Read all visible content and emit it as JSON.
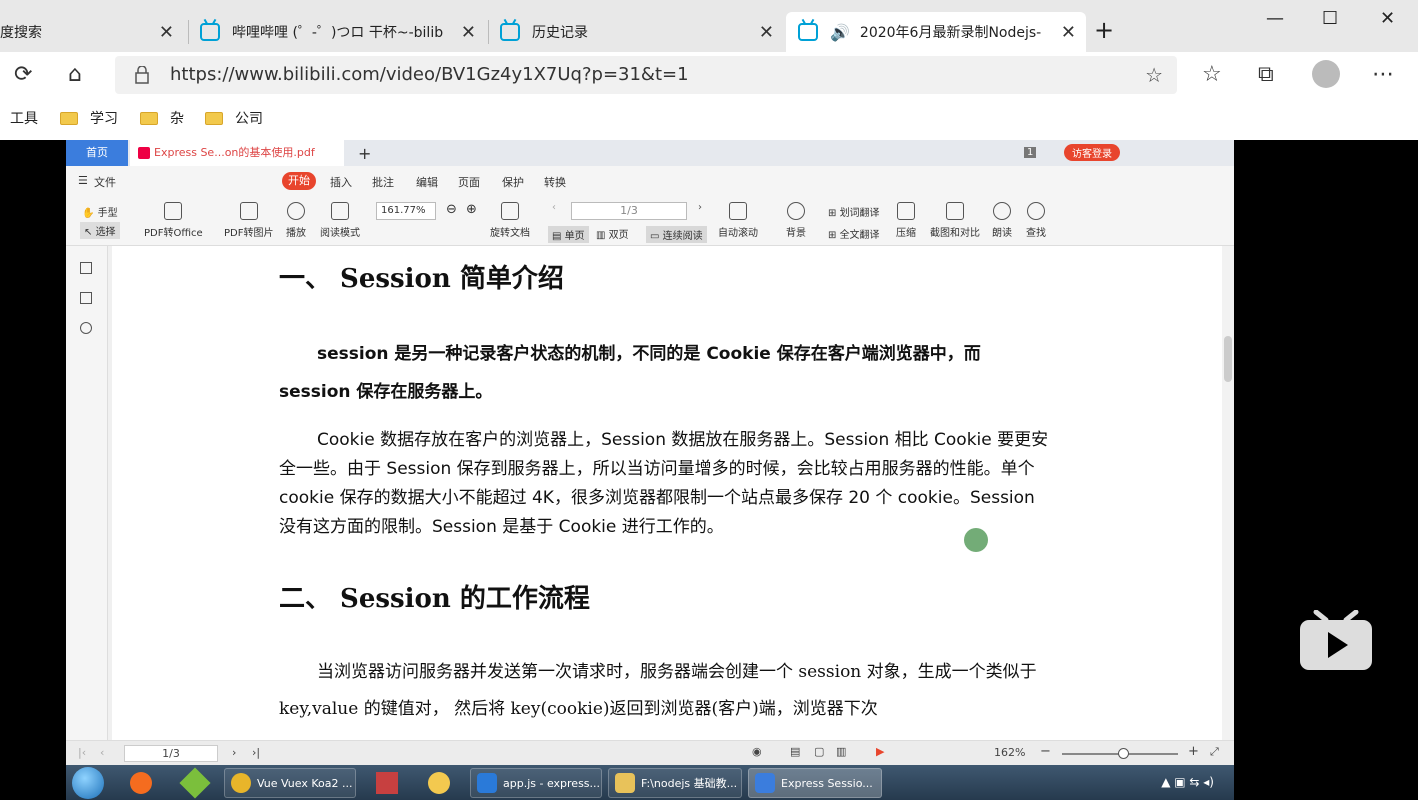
{
  "tabs": [
    {
      "title": "度搜索",
      "close": "✕"
    },
    {
      "title": "哔哩哔哩 (゜-゜)つロ 干杯~-bilib",
      "close": "✕"
    },
    {
      "title": "历史记录",
      "close": "✕"
    },
    {
      "title": "2020年6月最新录制Nodejs-",
      "close": "✕"
    }
  ],
  "new_tab": "+",
  "window_controls": {
    "minimize": "—",
    "maximize": "☐",
    "close": "✕"
  },
  "url": "https://www.bilibili.com/video/BV1Gz4y1X7Uq?p=31&t=1",
  "favorites": {
    "tools": "工具",
    "items": [
      "学习",
      "杂",
      "公司"
    ]
  },
  "wps": {
    "home_tab": "首页",
    "doc_tab": "Express  Se...on的基本使用.pdf",
    "add_tab": "+",
    "page_badge": "1",
    "login": "访客登录",
    "menu": {
      "file": "文件",
      "start": "开始",
      "insert": "插入",
      "annotate": "批注",
      "edit": "编辑",
      "page": "页面",
      "protect": "保护",
      "convert": "转换"
    },
    "toolbar": {
      "hand": "手型",
      "select": "选择",
      "pdf_to_office": "PDF转Office",
      "pdf_to_image": "PDF转图片",
      "play": "播放",
      "read_mode": "阅读模式",
      "zoom": "161.77%",
      "rotate": "旋转文档",
      "page_field": "1/3",
      "single": "单页",
      "double": "双页",
      "continuous": "连续阅读",
      "autoscroll": "自动滚动",
      "background": "背景",
      "word_translate": "划词翻译",
      "full_translate": "全文翻译",
      "compress": "压缩",
      "screenshot": "截图和对比",
      "read_aloud": "朗读",
      "find": "查找"
    },
    "document": {
      "h1": "一、   Session 简单介绍",
      "p1": "session 是另一种记录客户状态的机制，不同的是 Cookie 保存在客户端浏览器中，而 session 保存在服务器上。",
      "p2": "Cookie 数据存放在客户的浏览器上，Session 数据放在服务器上。Session 相比 Cookie 要更安全一些。由于 Session 保存到服务器上，所以当访问量增多的时候，会比较占用服务器的性能。单个 cookie 保存的数据大小不能超过 4K，很多浏览器都限制一个站点最多保存 20 个 cookie。Session 没有这方面的限制。Session 是基于 Cookie 进行工作的。",
      "h2": "二、   Session 的工作流程",
      "p3": "当浏览器访问服务器并发送第一次请求时，服务器端会创建一个 session 对象，生成一个类似于 key,value 的键值对，  然后将 key(cookie)返回到浏览器(客户)端，浏览器下次"
    },
    "status": {
      "page": "1/3",
      "zoom": "162%",
      "minus": "−",
      "plus": "+"
    }
  },
  "taskbar": [
    {
      "label": "Vue Vuex Koa2 ...",
      "color": "#e8b52a"
    },
    {
      "label": "app.js - express...",
      "color": "#2a7ad9"
    },
    {
      "label": "F:\\nodejs 基础教...",
      "color": "#e8c25a"
    },
    {
      "label": "Express  Sessio...",
      "color": "#3b7ddd"
    }
  ]
}
